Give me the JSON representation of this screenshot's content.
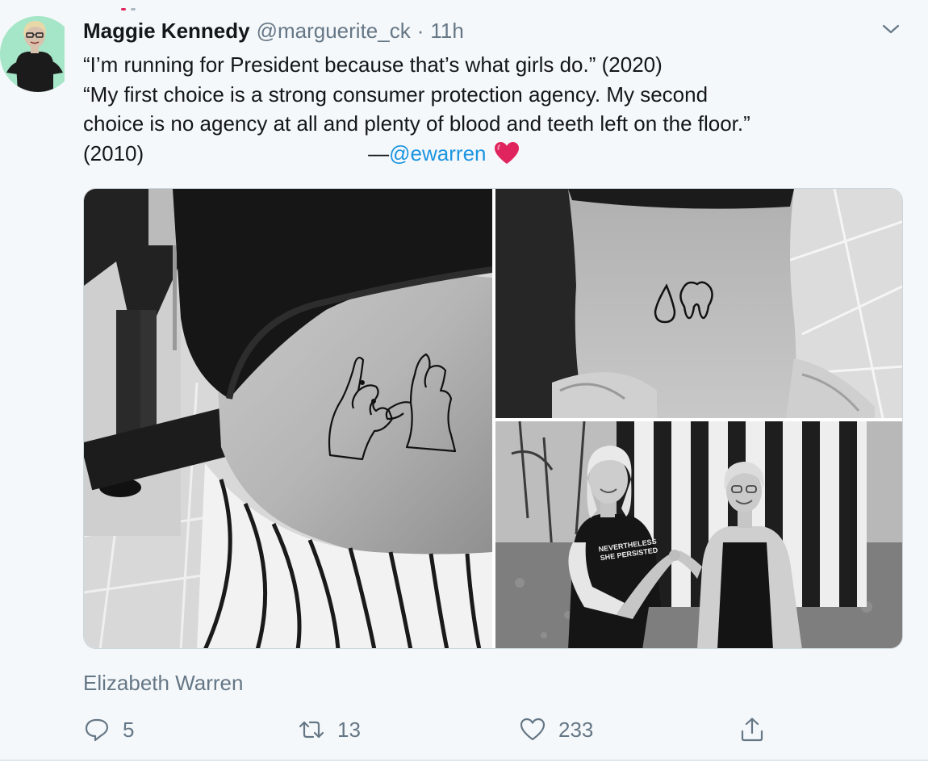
{
  "tweet": {
    "author_name": "Maggie Kennedy",
    "author_handle": "@marguerite_ck",
    "separator": "·",
    "time": "11h",
    "text": {
      "line1": "“I’m running for President because that’s what girls do.” (2020)",
      "line2": "“My first choice is a strong consumer protection agency. My second",
      "line3": "choice is no agency at all and plenty of blood and teeth left on the floor.”",
      "line4_year": "(2010)",
      "line4_dash": "—",
      "mention": "@ewarren"
    },
    "card_caption": "Elizabeth Warren",
    "tattoo_lettering": "NEVERTHELESS SHE PERSISTED",
    "actions": {
      "replies": "5",
      "retweets": "13",
      "likes": "233"
    },
    "icons": {
      "menu": "chevron-down-icon",
      "reply": "reply-icon",
      "retweet": "retweet-icon",
      "like": "heart-icon",
      "share": "share-icon",
      "emoji": "red-heart-emoji"
    },
    "colors": {
      "link": "#1b95e0",
      "muted": "#657786",
      "text": "#14171a",
      "avatar_bg": "#a6e6c8",
      "emoji_heart": "#e0245e"
    }
  }
}
